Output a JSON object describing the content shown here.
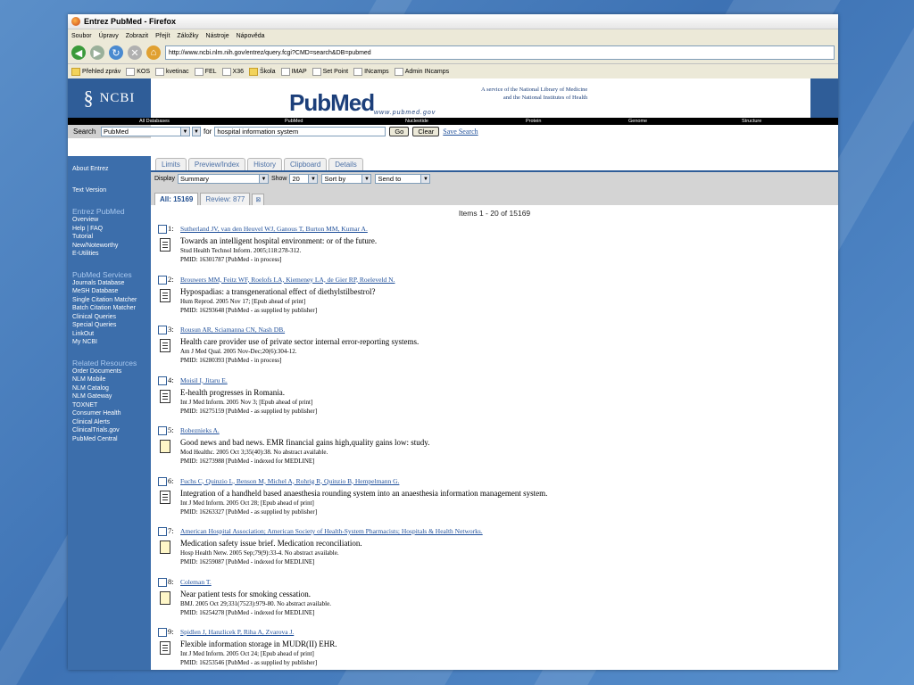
{
  "window": {
    "title": "Entrez PubMed - Firefox"
  },
  "menu": [
    "Soubor",
    "Úpravy",
    "Zobrazit",
    "Přejít",
    "Záložky",
    "Nástroje",
    "Nápověda"
  ],
  "url": "http://www.ncbi.nlm.nih.gov/entrez/query.fcgi?CMD=search&DB=pubmed",
  "bookmarks": [
    {
      "label": "Přehled zpráv",
      "folder": true
    },
    {
      "label": "KOS",
      "folder": false
    },
    {
      "label": "kvetinac",
      "folder": false
    },
    {
      "label": "FEL",
      "folder": false
    },
    {
      "label": "X36",
      "folder": false
    },
    {
      "label": "Škola",
      "folder": true
    },
    {
      "label": "IMAP",
      "folder": false
    },
    {
      "label": "Set Point",
      "folder": false
    },
    {
      "label": "INcamps",
      "folder": false
    },
    {
      "label": "Admin INcamps",
      "folder": false
    }
  ],
  "banner": {
    "ncbi": "NCBI",
    "pubmed_logo": "PubMed",
    "pubmed_url": "www.pubmed.gov",
    "service_line1": "A service of the National Library of Medicine",
    "service_line2": "and the National Institutes of Health"
  },
  "dbbar": [
    "All Databases",
    "PubMed",
    "Nucleotide",
    "Protein",
    "Genome",
    "Structure"
  ],
  "search": {
    "label": "Search",
    "db": "PubMed",
    "for": "for",
    "query": "hospital information system",
    "go": "Go",
    "clear": "Clear",
    "save": "Save Search"
  },
  "tabs": [
    "Limits",
    "Preview/Index",
    "History",
    "Clipboard",
    "Details"
  ],
  "toolbar": {
    "display": "Display",
    "display_value": "Summary",
    "show": "Show",
    "show_value": "20",
    "sortby": "Sort by",
    "sendto": "Send to"
  },
  "result_tabs": {
    "all": "All: 15169",
    "review": "Review: 877"
  },
  "items_count": "Items 1 - 20 of 15169",
  "sidebar": {
    "top": [
      "About Entrez",
      "Text Version"
    ],
    "sections": [
      {
        "title": "Entrez PubMed",
        "items": [
          "Overview",
          "Help | FAQ",
          "Tutorial",
          "New/Noteworthy",
          "E-Utilities"
        ]
      },
      {
        "title": "PubMed Services",
        "items": [
          "Journals Database",
          "MeSH Database",
          "Single Citation Matcher",
          "Batch Citation Matcher",
          "Clinical Queries",
          "Special Queries",
          "LinkOut",
          "My NCBI"
        ]
      },
      {
        "title": "Related Resources",
        "items": [
          "Order Documents",
          "NLM Mobile",
          "NLM Catalog",
          "NLM Gateway",
          "TOXNET",
          "Consumer Health",
          "Clinical Alerts",
          "ClinicalTrials.gov",
          "PubMed Central"
        ]
      }
    ]
  },
  "results": [
    {
      "num": "1:",
      "authors": "Sutherland JV, van den Heuvel WJ, Ganous T, Burton MM, Kumar A.",
      "title": "Towards an intelligent hospital environment: or of the future.",
      "source": "Stud Health Technol Inform. 2005;118:278-312.",
      "pmid": "PMID: 16301787 [PubMed - in process]",
      "abstract": true
    },
    {
      "num": "2:",
      "authors": "Brouwers MM, Feitz WF, Roelofs LA, Kiemeney LA, de Gier RP, Roeleveld N.",
      "title": "Hypospadias: a transgenerational effect of diethylstilbestrol?",
      "source": "Hum Reprod. 2005 Nov 17; [Epub ahead of print]",
      "pmid": "PMID: 16293648 [PubMed - as supplied by publisher]",
      "abstract": true
    },
    {
      "num": "3:",
      "authors": "Rousun AR, Sciamanna CN, Nash DB.",
      "title": "Health care provider use of private sector internal error-reporting systems.",
      "source": "Am J Med Qual. 2005 Nov-Dec;20(6):304-12.",
      "pmid": "PMID: 16280393 [PubMed - in process]",
      "abstract": true
    },
    {
      "num": "4:",
      "authors": "Moisil I, Jitaru E.",
      "title": "E-health progresses in Romania.",
      "source": "Int J Med Inform. 2005 Nov 3; [Epub ahead of print]",
      "pmid": "PMID: 16275159 [PubMed - as supplied by publisher]",
      "abstract": true
    },
    {
      "num": "5:",
      "authors": "Robeznieks A.",
      "title": "Good news and bad news. EMR financial gains high,quality gains low: study.",
      "source": "Mod Healthc. 2005 Oct 3;35(40):38. No abstract available.",
      "pmid": "PMID: 16273988 [PubMed - indexed for MEDLINE]",
      "abstract": false
    },
    {
      "num": "6:",
      "authors": "Fuchs C, Quinzio L, Benson M, Michel A, Rohrig R, Quinzio B, Hempelmann G.",
      "title": "Integration of a handheld based anaesthesia rounding system into an anaesthesia information management system.",
      "source": "Int J Med Inform. 2005 Oct 28; [Epub ahead of print]",
      "pmid": "PMID: 16263327 [PubMed - as supplied by publisher]",
      "abstract": true
    },
    {
      "num": "7:",
      "authors": "American Hospital Association; American Society of Health-System Pharmacists; Hospitals & Health Networks.",
      "title": "Medication safety issue brief. Medication reconciliation.",
      "source": "Hosp Health Netw. 2005 Sep;79(9):33-4. No abstract available.",
      "pmid": "PMID: 16259087 [PubMed - indexed for MEDLINE]",
      "abstract": false
    },
    {
      "num": "8:",
      "authors": "Coleman T.",
      "title": "Near patient tests for smoking cessation.",
      "source": "BMJ. 2005 Oct 29;331(7523):979-80. No abstract available.",
      "pmid": "PMID: 16254278 [PubMed - indexed for MEDLINE]",
      "abstract": false
    },
    {
      "num": "9:",
      "authors": "Spidlen J, Hanzlicek P, Riha A, Zvarova J.",
      "title": "Flexible information storage in MUDR(II) EHR.",
      "source": "Int J Med Inform. 2005 Oct 24; [Epub ahead of print]",
      "pmid": "PMID: 16253546 [PubMed - as supplied by publisher]",
      "abstract": true
    }
  ]
}
